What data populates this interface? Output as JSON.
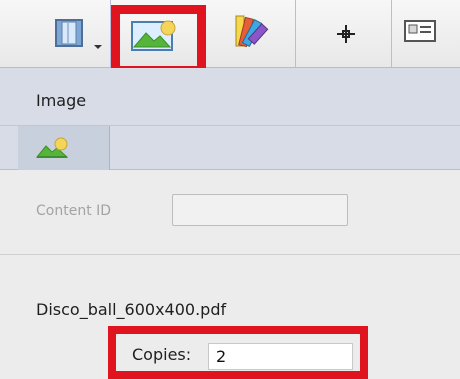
{
  "toolbar": {
    "items": [
      {
        "name": "frame-tool",
        "label": ""
      },
      {
        "name": "image-tool",
        "label": ""
      },
      {
        "name": "swatch-tool",
        "label": ""
      },
      {
        "name": "crosshair-tool",
        "label": ""
      },
      {
        "name": "layout-tool",
        "label": ""
      }
    ]
  },
  "panel": {
    "title": "Image",
    "content_id_label": "Content ID",
    "file_name": "Disco_ball_600x400.pdf",
    "copies_label": "Copies:",
    "copies_value": "2"
  },
  "colors": {
    "highlight": "#e0141f",
    "panel_band": "#d7dce7",
    "background": "#ececec"
  }
}
